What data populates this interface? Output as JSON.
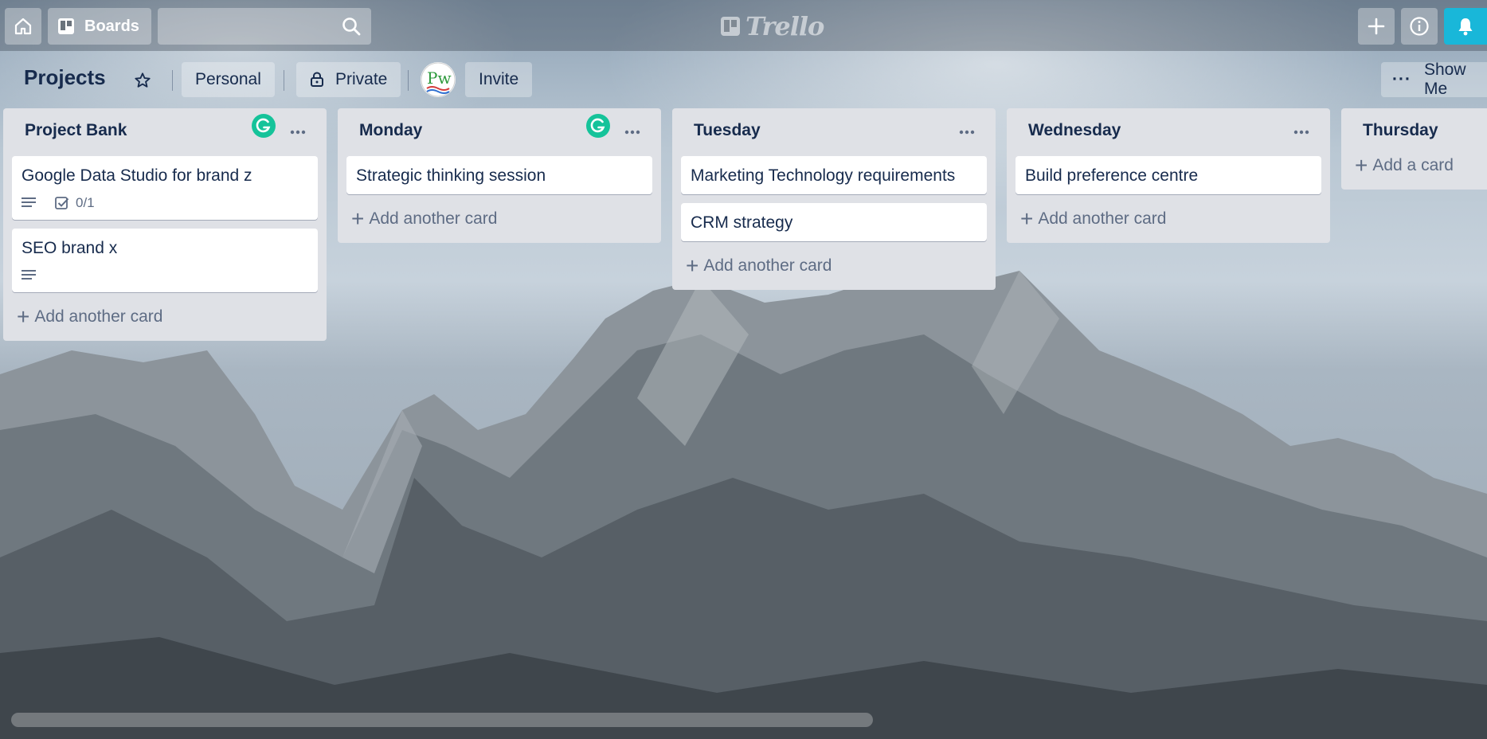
{
  "nav": {
    "home_icon": "home-icon",
    "boards_label": "Boards",
    "search_value": "",
    "search_placeholder": "",
    "logo_text": "Trello",
    "plus_icon": "plus-icon",
    "info_icon": "info-icon",
    "bell_icon": "bell-icon",
    "bell_color": "#19b7d9"
  },
  "board": {
    "title": "Projects",
    "visibility_team": "Personal",
    "visibility": "Private",
    "invite_label": "Invite",
    "show_menu_label": "Show Me",
    "avatar_initials": "Pw"
  },
  "lists": [
    {
      "title": "Project Bank",
      "grammarly": true,
      "cards": [
        {
          "title": "Google Data Studio for brand z",
          "has_description": true,
          "checklist": "0/1"
        },
        {
          "title": "SEO brand x",
          "has_description": true
        }
      ],
      "add_label": "Add another card"
    },
    {
      "title": "Monday",
      "grammarly": true,
      "cards": [
        {
          "title": "Strategic thinking session"
        }
      ],
      "add_label": "Add another card"
    },
    {
      "title": "Tuesday",
      "cards": [
        {
          "title": "Marketing Technology requirements"
        },
        {
          "title": "CRM strategy"
        }
      ],
      "add_label": "Add another card"
    },
    {
      "title": "Wednesday",
      "cards": [
        {
          "title": "Build preference centre"
        }
      ],
      "add_label": "Add another card"
    },
    {
      "title": "Thursday",
      "cards": [],
      "add_label": "Add a card"
    }
  ],
  "colors": {
    "grammarly": "#15c39a",
    "text_primary": "#172b4d",
    "text_muted": "#5e6c84",
    "list_bg": "#dfe1e6"
  }
}
